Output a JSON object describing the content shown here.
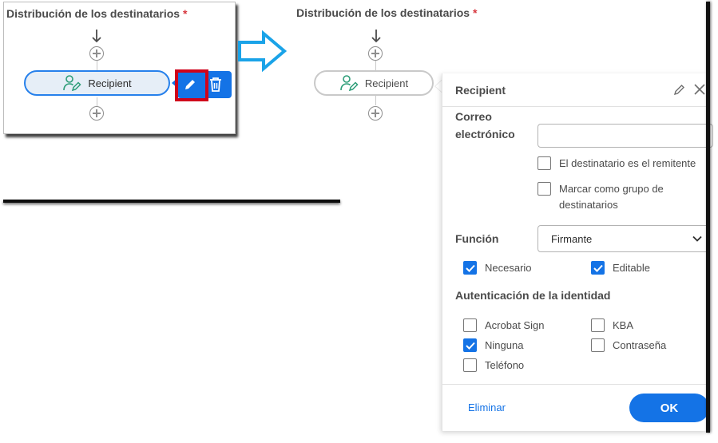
{
  "section_title": "Distribución de los destinatarios",
  "required_mark": "*",
  "recipient_node": {
    "label": "Recipient"
  },
  "dialog": {
    "title": "Recipient",
    "email_label_line1": "Correo",
    "email_label_line2": "electrónico",
    "email_value": "",
    "sender_is_recipient": {
      "label": "El destinatario es el remitente",
      "checked": false
    },
    "recipient_group": {
      "label_line1": "Marcar como grupo de",
      "label_line2": "destinatarios",
      "checked": false
    },
    "role_label": "Función",
    "role_value": "Firmante",
    "required_opt": {
      "label": "Necesario",
      "checked": true
    },
    "editable_opt": {
      "label": "Editable",
      "checked": true
    },
    "auth_title": "Autenticación de la identidad",
    "auth_options": [
      {
        "label": "Acrobat Sign",
        "checked": false
      },
      {
        "label": "KBA",
        "checked": false
      },
      {
        "label": "Ninguna",
        "checked": true
      },
      {
        "label": "Contraseña",
        "checked": false
      },
      {
        "label": "Teléfono",
        "checked": false
      }
    ],
    "delete_label": "Eliminar",
    "ok_label": "OK"
  },
  "colors": {
    "accent": "#1473e6",
    "highlight": "#d0021b",
    "icon_green": "#2d9d78"
  },
  "icons": [
    "arrow-down-icon",
    "plus-circle-icon",
    "user-edit-icon",
    "pencil-icon",
    "trash-icon",
    "close-icon",
    "chevron-down-icon",
    "checkmark-icon"
  ]
}
